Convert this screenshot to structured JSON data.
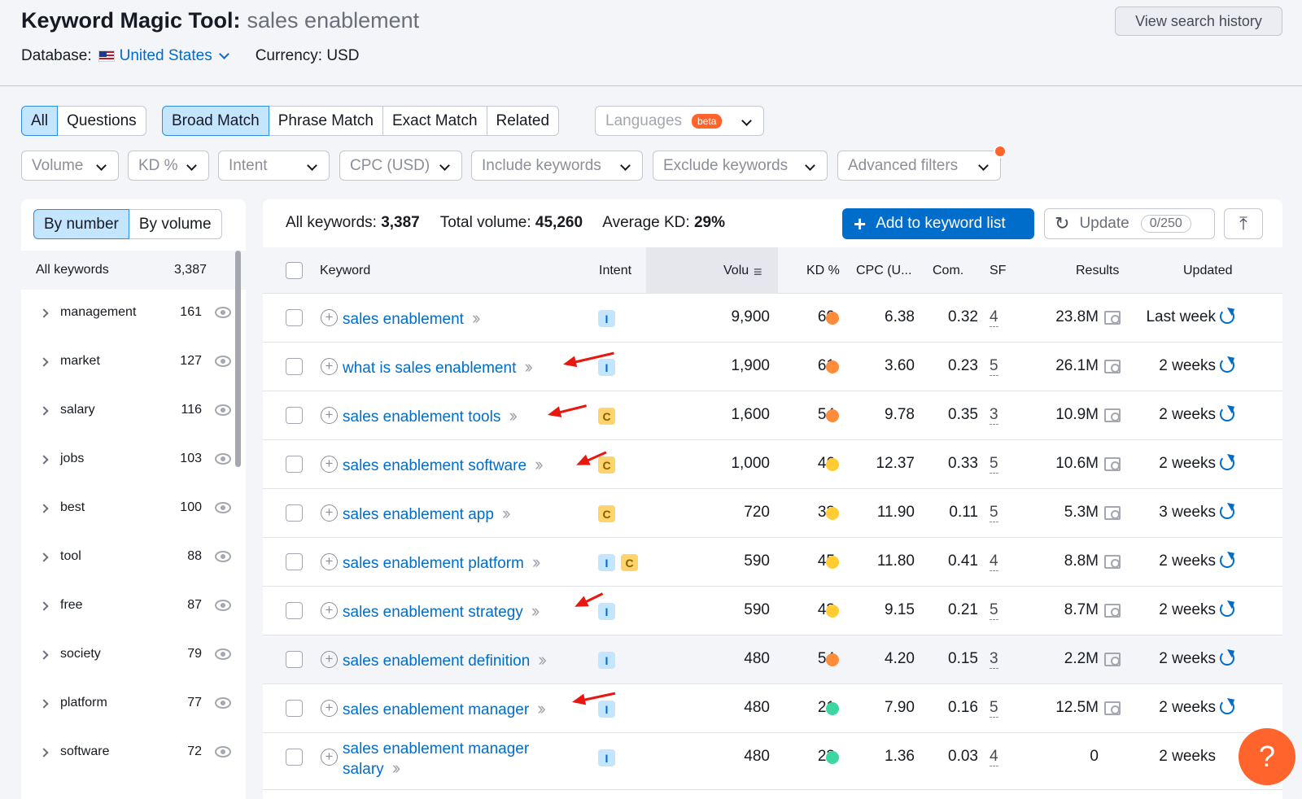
{
  "header": {
    "title": "Keyword Magic Tool:",
    "query": "sales enablement",
    "database_label": "Database:",
    "database_value": "United States",
    "currency": "Currency: USD",
    "history_button": "View search history"
  },
  "tabs": {
    "scope": [
      "All",
      "Questions"
    ],
    "match": [
      "Broad Match",
      "Phrase Match",
      "Exact Match",
      "Related"
    ],
    "languages": "Languages",
    "beta": "beta"
  },
  "filters": [
    "Volume",
    "KD %",
    "Intent",
    "CPC (USD)",
    "Include keywords",
    "Exclude keywords",
    "Advanced filters"
  ],
  "sidebar": {
    "sort_tabs": [
      "By number",
      "By volume"
    ],
    "all_label": "All keywords",
    "all_count": "3,387",
    "groups": [
      {
        "label": "management",
        "count": "161"
      },
      {
        "label": "market",
        "count": "127"
      },
      {
        "label": "salary",
        "count": "116"
      },
      {
        "label": "jobs",
        "count": "103"
      },
      {
        "label": "best",
        "count": "100"
      },
      {
        "label": "tool",
        "count": "88"
      },
      {
        "label": "free",
        "count": "87"
      },
      {
        "label": "society",
        "count": "79"
      },
      {
        "label": "platform",
        "count": "77"
      },
      {
        "label": "software",
        "count": "72"
      }
    ]
  },
  "summary": {
    "all_keywords_label": "All keywords:",
    "all_keywords_value": "3,387",
    "total_volume_label": "Total volume:",
    "total_volume_value": "45,260",
    "avg_kd_label": "Average KD:",
    "avg_kd_value": "29%",
    "add_button": "Add to keyword list",
    "update_button": "Update",
    "update_count": "0/250"
  },
  "table": {
    "columns": [
      "Keyword",
      "Intent",
      "Volu",
      "KD %",
      "CPC (U...",
      "Com.",
      "SF",
      "Results",
      "Updated"
    ],
    "rows": [
      {
        "keyword": "sales enablement",
        "intent": [
          "I"
        ],
        "volume": "9,900",
        "kd": "60",
        "kd_color": "#ff8c3b",
        "cpc": "6.38",
        "com": "0.32",
        "sf": "4",
        "results": "23.8M",
        "updated": "Last week"
      },
      {
        "keyword": "what is sales enablement",
        "intent": [
          "I"
        ],
        "volume": "1,900",
        "kd": "61",
        "kd_color": "#ff8c3b",
        "cpc": "3.60",
        "com": "0.23",
        "sf": "5",
        "results": "26.1M",
        "updated": "2 weeks"
      },
      {
        "keyword": "sales enablement tools",
        "intent": [
          "C"
        ],
        "volume": "1,600",
        "kd": "54",
        "kd_color": "#ff8c3b",
        "cpc": "9.78",
        "com": "0.35",
        "sf": "3",
        "results": "10.9M",
        "updated": "2 weeks"
      },
      {
        "keyword": "sales enablement software",
        "intent": [
          "C"
        ],
        "volume": "1,000",
        "kd": "46",
        "kd_color": "#ffcc33",
        "cpc": "12.37",
        "com": "0.33",
        "sf": "5",
        "results": "10.6M",
        "updated": "2 weeks"
      },
      {
        "keyword": "sales enablement app",
        "intent": [
          "C"
        ],
        "volume": "720",
        "kd": "33",
        "kd_color": "#ffcc33",
        "cpc": "11.90",
        "com": "0.11",
        "sf": "5",
        "results": "5.3M",
        "updated": "3 weeks"
      },
      {
        "keyword": "sales enablement platform",
        "intent": [
          "I",
          "C"
        ],
        "volume": "590",
        "kd": "45",
        "kd_color": "#ffcc33",
        "cpc": "11.80",
        "com": "0.41",
        "sf": "4",
        "results": "8.8M",
        "updated": "2 weeks"
      },
      {
        "keyword": "sales enablement strategy",
        "intent": [
          "I"
        ],
        "volume": "590",
        "kd": "43",
        "kd_color": "#ffcc33",
        "cpc": "9.15",
        "com": "0.21",
        "sf": "5",
        "results": "8.7M",
        "updated": "2 weeks"
      },
      {
        "keyword": "sales enablement definition",
        "intent": [
          "I"
        ],
        "volume": "480",
        "kd": "54",
        "kd_color": "#ff8c3b",
        "cpc": "4.20",
        "com": "0.15",
        "sf": "3",
        "results": "2.2M",
        "updated": "2 weeks"
      },
      {
        "keyword": "sales enablement manager",
        "intent": [
          "I"
        ],
        "volume": "480",
        "kd": "21",
        "kd_color": "#3dd6a0",
        "cpc": "7.90",
        "com": "0.16",
        "sf": "5",
        "results": "12.5M",
        "updated": "2 weeks"
      },
      {
        "keyword": "sales enablement manager salary",
        "intent": [
          "I"
        ],
        "volume": "480",
        "kd": "23",
        "kd_color": "#3dd6a0",
        "cpc": "1.36",
        "com": "0.03",
        "sf": "4",
        "results": "0",
        "updated": "2 weeks"
      }
    ]
  },
  "help": "?",
  "colors": {
    "accent": "#006dca",
    "brand_orange": "#ff642d",
    "annotation_red": "#e8170f"
  }
}
